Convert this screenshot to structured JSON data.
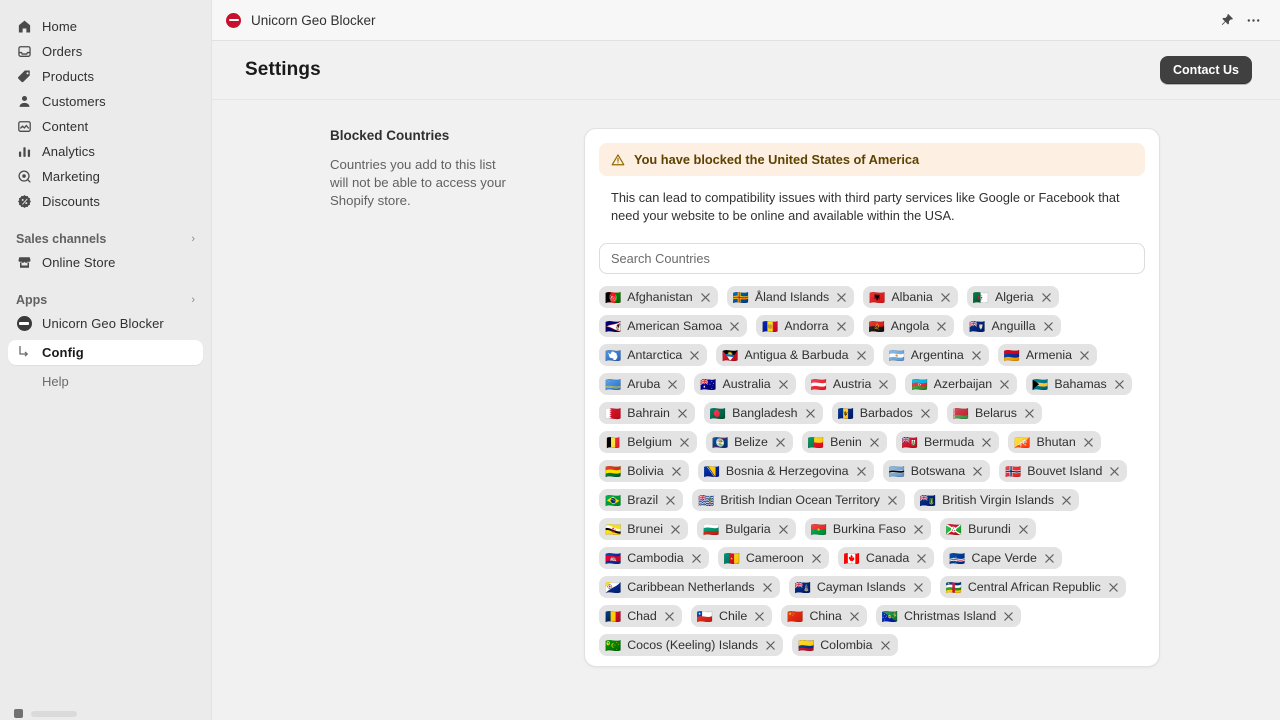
{
  "sidebar": {
    "main_items": [
      {
        "label": "Home",
        "icon": "home-icon"
      },
      {
        "label": "Orders",
        "icon": "orders-icon"
      },
      {
        "label": "Products",
        "icon": "tag-icon"
      },
      {
        "label": "Customers",
        "icon": "person-icon"
      },
      {
        "label": "Content",
        "icon": "content-icon"
      },
      {
        "label": "Analytics",
        "icon": "bar-chart-icon"
      },
      {
        "label": "Marketing",
        "icon": "target-icon"
      },
      {
        "label": "Discounts",
        "icon": "discount-icon"
      }
    ],
    "sales_channels": {
      "label": "Sales channels",
      "chevron": "›"
    },
    "online_store": {
      "label": "Online Store",
      "icon": "store-icon"
    },
    "apps": {
      "label": "Apps",
      "chevron": "›"
    },
    "app_item": {
      "label": "Unicorn Geo Blocker",
      "icon": "no-entry-icon"
    },
    "config_item": {
      "label": "Config"
    },
    "help_item": {
      "label": "Help"
    }
  },
  "topbar": {
    "app_title": "Unicorn Geo Blocker",
    "pin_icon": "pin-icon",
    "more_icon": "more-horizontal-icon"
  },
  "page": {
    "title": "Settings",
    "contact_label": "Contact Us"
  },
  "section": {
    "heading": "Blocked Countries",
    "description": "Countries you add to this list will not be able to access your Shopify store."
  },
  "banner": {
    "icon": "warning-triangle-icon",
    "title": "You have blocked the United States of America",
    "body": "This can lead to compatibility issues with third party services like Google or Facebook that need your website to be online and available within the USA."
  },
  "search": {
    "placeholder": "Search Countries",
    "value": ""
  },
  "countries": [
    {
      "flag": "🇦🇫",
      "name": "Afghanistan"
    },
    {
      "flag": "🇦🇽",
      "name": "Åland Islands"
    },
    {
      "flag": "🇦🇱",
      "name": "Albania"
    },
    {
      "flag": "🇩🇿",
      "name": "Algeria"
    },
    {
      "flag": "🇦🇸",
      "name": "American Samoa"
    },
    {
      "flag": "🇦🇩",
      "name": "Andorra"
    },
    {
      "flag": "🇦🇴",
      "name": "Angola"
    },
    {
      "flag": "🇦🇮",
      "name": "Anguilla"
    },
    {
      "flag": "🇦🇶",
      "name": "Antarctica"
    },
    {
      "flag": "🇦🇬",
      "name": "Antigua & Barbuda"
    },
    {
      "flag": "🇦🇷",
      "name": "Argentina"
    },
    {
      "flag": "🇦🇲",
      "name": "Armenia"
    },
    {
      "flag": "🇦🇼",
      "name": "Aruba"
    },
    {
      "flag": "🇦🇺",
      "name": "Australia"
    },
    {
      "flag": "🇦🇹",
      "name": "Austria"
    },
    {
      "flag": "🇦🇿",
      "name": "Azerbaijan"
    },
    {
      "flag": "🇧🇸",
      "name": "Bahamas"
    },
    {
      "flag": "🇧🇭",
      "name": "Bahrain"
    },
    {
      "flag": "🇧🇩",
      "name": "Bangladesh"
    },
    {
      "flag": "🇧🇧",
      "name": "Barbados"
    },
    {
      "flag": "🇧🇾",
      "name": "Belarus"
    },
    {
      "flag": "🇧🇪",
      "name": "Belgium"
    },
    {
      "flag": "🇧🇿",
      "name": "Belize"
    },
    {
      "flag": "🇧🇯",
      "name": "Benin"
    },
    {
      "flag": "🇧🇲",
      "name": "Bermuda"
    },
    {
      "flag": "🇧🇹",
      "name": "Bhutan"
    },
    {
      "flag": "🇧🇴",
      "name": "Bolivia"
    },
    {
      "flag": "🇧🇦",
      "name": "Bosnia & Herzegovina"
    },
    {
      "flag": "🇧🇼",
      "name": "Botswana"
    },
    {
      "flag": "🇧🇻",
      "name": "Bouvet Island"
    },
    {
      "flag": "🇧🇷",
      "name": "Brazil"
    },
    {
      "flag": "🇮🇴",
      "name": "British Indian Ocean Territory"
    },
    {
      "flag": "🇻🇬",
      "name": "British Virgin Islands"
    },
    {
      "flag": "🇧🇳",
      "name": "Brunei"
    },
    {
      "flag": "🇧🇬",
      "name": "Bulgaria"
    },
    {
      "flag": "🇧🇫",
      "name": "Burkina Faso"
    },
    {
      "flag": "🇧🇮",
      "name": "Burundi"
    },
    {
      "flag": "🇰🇭",
      "name": "Cambodia"
    },
    {
      "flag": "🇨🇲",
      "name": "Cameroon"
    },
    {
      "flag": "🇨🇦",
      "name": "Canada"
    },
    {
      "flag": "🇨🇻",
      "name": "Cape Verde"
    },
    {
      "flag": "🇧🇶",
      "name": "Caribbean Netherlands"
    },
    {
      "flag": "🇰🇾",
      "name": "Cayman Islands"
    },
    {
      "flag": "🇨🇫",
      "name": "Central African Republic"
    },
    {
      "flag": "🇹🇩",
      "name": "Chad"
    },
    {
      "flag": "🇨🇱",
      "name": "Chile"
    },
    {
      "flag": "🇨🇳",
      "name": "China"
    },
    {
      "flag": "🇨🇽",
      "name": "Christmas Island"
    },
    {
      "flag": "🇨🇨",
      "name": "Cocos (Keeling) Islands"
    },
    {
      "flag": "🇨🇴",
      "name": "Colombia"
    }
  ],
  "chip_remove_label": "✕",
  "colors": {
    "sidebar_bg": "#ebebeb",
    "content_bg": "#f1f1f2",
    "card_bg": "#ffffff",
    "chip_bg": "#e3e3e3",
    "banner_bg": "#fdf0e3",
    "banner_text": "#5e4200",
    "button_dark": "#404040",
    "brand_red": "#c8102e"
  }
}
